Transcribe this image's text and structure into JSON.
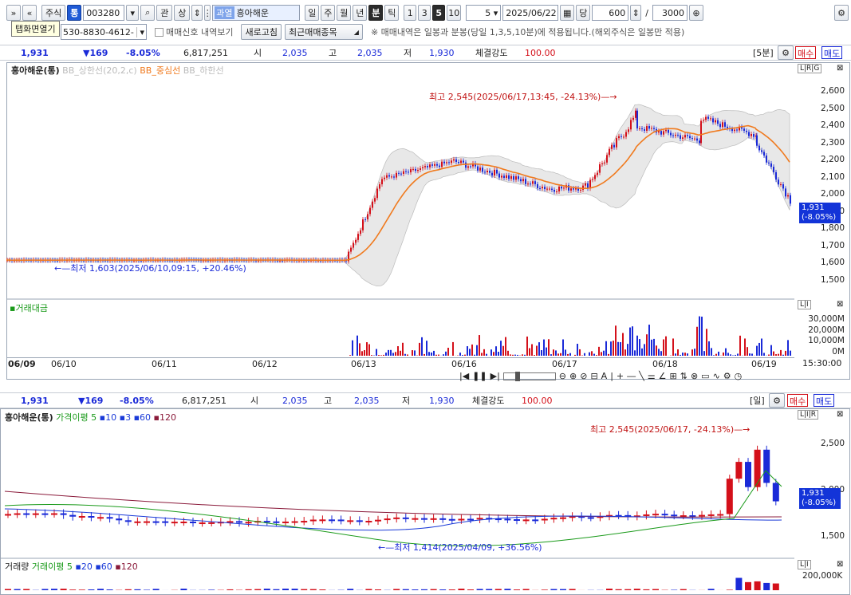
{
  "toolbar": {
    "expand": "»",
    "collapse": "«",
    "stock_label": "주식",
    "tong_label": "통",
    "code": "003280",
    "search_icon": "search-icon",
    "gwan_label": "관",
    "sang_label": "상",
    "market_tag": "과열",
    "stock_name": "흥아해운",
    "periods": [
      "일",
      "주",
      "월",
      "년",
      "분",
      "틱"
    ],
    "selected_period": "분",
    "minute_buttons": [
      "1",
      "3",
      "5",
      "10"
    ],
    "selected_minute": "5",
    "minute_value": "5",
    "date": "2025/06/22",
    "dang_label": "당",
    "count": "600",
    "slash": "/",
    "max_count": "3000"
  },
  "tooltip": "탭화면열기",
  "row2": {
    "account": "530-8830-4612-",
    "signal_label": "매매신호 내역보기",
    "refresh": "새로고침",
    "recent": "최근매매종목",
    "notice": "※ 매매내역은 일봉과 분봉(당일 1,3,5,10분)에 적용됩니다.(해외주식은 일봉만 적용)"
  },
  "quote": {
    "price": "1,931",
    "change": "▼169",
    "rate": "-8.05%",
    "volume": "6,817,251",
    "open_label": "시",
    "open": "2,035",
    "high_label": "고",
    "high": "2,035",
    "low_label": "저",
    "low": "1,930",
    "strength_label": "체결강도",
    "strength": "100.00"
  },
  "chart_top": {
    "period_tag": "[5분]",
    "buy": "매수",
    "sell": "매도",
    "title": "흥아해운(통)",
    "legend": [
      {
        "label": "BB_상한선(20,2,c)",
        "color": "#bbbbbb"
      },
      {
        "label": "BB_중심선",
        "color": "#f07a1e"
      },
      {
        "label": "BB_하한선",
        "color": "#bbbbbb"
      }
    ],
    "high_note": "최고 2,545(2025/06/17,13:45, -24.13%)",
    "low_note": "최저 1,603(2025/06/10,09:15, +20.46%)",
    "y_ticks": [
      "2,600",
      "2,500",
      "2,400",
      "2,300",
      "2,200",
      "2,100",
      "2,000",
      "1,900",
      "1,800",
      "1,700",
      "1,600",
      "1,500"
    ],
    "price_tag": "1,931",
    "price_tag_rate": "(-8.05%)",
    "volume_title": "거래대금",
    "vol_ticks": [
      "30,000M",
      "20,000M",
      "10,000M",
      "0M"
    ],
    "x_ticks": [
      "06/09",
      "06/10",
      "06/11",
      "06/12",
      "06/13",
      "06/16",
      "06/17",
      "06/18",
      "06/19"
    ],
    "time": "15:30:00"
  },
  "chart_bottom": {
    "period_tag": "[일]",
    "buy": "매수",
    "sell": "매도",
    "title": "흥아해운(통)",
    "legend_main": "가격이평",
    "legend_items": [
      {
        "label": "5",
        "color": "#1a9a1a"
      },
      {
        "label": "10",
        "color": "#1a3ad8"
      },
      {
        "label": "3",
        "color": "#1a3ad8"
      },
      {
        "label": "60",
        "color": "#1a3ad8"
      },
      {
        "label": "120",
        "color": "#8a1a3a"
      }
    ],
    "high_note": "최고 2,545(2025/06/17, -24.13%)",
    "low_note": "최저 1,414(2025/04/09, +36.56%)",
    "y_ticks": [
      "2,500",
      "2,000",
      "1,500"
    ],
    "price_tag": "1,931",
    "price_tag_rate": "(-8.05%)",
    "vol_title": "거래량",
    "vol_legend_main": "거래이평",
    "vol_legend_items": [
      {
        "label": "5",
        "color": "#1a9a1a"
      },
      {
        "label": "20",
        "color": "#1a3ad8"
      },
      {
        "label": "60",
        "color": "#1a3ad8"
      },
      {
        "label": "120",
        "color": "#8a1a3a"
      }
    ],
    "vol_tick": "200,000K"
  },
  "colors": {
    "up": "#d4101a",
    "down": "#1a2ad8",
    "bb_center": "#f07a1e",
    "band": "#e6e6e6",
    "price_tag": "#1334d8"
  }
}
